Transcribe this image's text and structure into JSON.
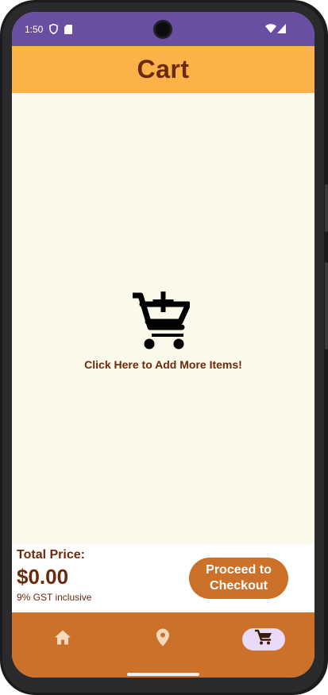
{
  "status_bar": {
    "time": "1:50",
    "left_icons": [
      "shield-icon",
      "sd-card-icon"
    ],
    "right_icons": [
      "wifi-icon",
      "signal-icon"
    ]
  },
  "app_bar": {
    "title": "Cart"
  },
  "empty_cart": {
    "icon": "add-to-cart-icon",
    "label": "Click Here to Add More Items!"
  },
  "summary": {
    "total_label": "Total Price:",
    "total_value": "$0.00",
    "gst_note": "9% GST inclusive",
    "checkout_label": "Proceed to Checkout"
  },
  "bottom_nav": {
    "items": [
      {
        "icon": "home-icon",
        "selected": false
      },
      {
        "icon": "location-pin-icon",
        "selected": false
      },
      {
        "icon": "shopping-cart-icon",
        "selected": true
      }
    ]
  },
  "colors": {
    "status_bar": "#6a4ea2",
    "app_bar": "#fbb248",
    "title_text": "#6b2a0d",
    "background": "#faf9ea",
    "accent": "#cc7129",
    "nav_selected_pill": "#ead9f8"
  }
}
